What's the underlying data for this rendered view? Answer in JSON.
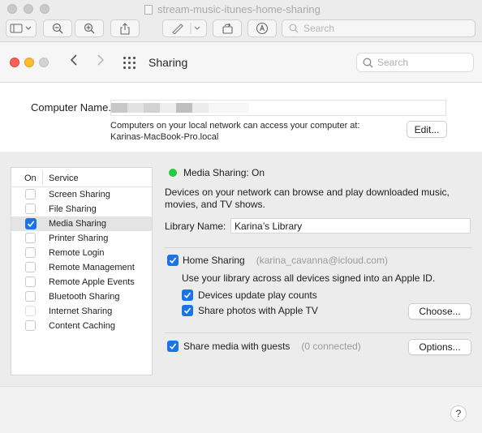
{
  "outer_window": {
    "title": "stream-music-itunes-home-sharing",
    "search_placeholder": "Search",
    "toolbar_icons": [
      "sidebar-icon",
      "zoom-out-icon",
      "zoom-in-icon",
      "share-icon",
      "markup-pen-icon",
      "rotate-icon",
      "annotate-icon"
    ]
  },
  "window": {
    "title": "Sharing",
    "search_placeholder": "Search",
    "colors": {
      "close": "#ff5f57",
      "minimize": "#febc2e",
      "zoom": "#d4d4d4"
    }
  },
  "computer_name": {
    "label": "Computer Name.",
    "description_line1": "Computers on your local network can access your computer at:",
    "description_line2": "Karinas-MacBook-Pro.local",
    "edit_button": "Edit..."
  },
  "services": {
    "header_on": "On",
    "header_service": "Service",
    "items": [
      {
        "label": "Screen Sharing",
        "checked": false,
        "selected": false
      },
      {
        "label": "File Sharing",
        "checked": false,
        "selected": false
      },
      {
        "label": "Media Sharing",
        "checked": true,
        "selected": true
      },
      {
        "label": "Printer Sharing",
        "checked": false,
        "selected": false
      },
      {
        "label": "Remote Login",
        "checked": false,
        "selected": false
      },
      {
        "label": "Remote Management",
        "checked": false,
        "selected": false
      },
      {
        "label": "Remote Apple Events",
        "checked": false,
        "selected": false
      },
      {
        "label": "Bluetooth Sharing",
        "checked": false,
        "selected": false
      },
      {
        "label": "Internet Sharing",
        "checked": false,
        "selected": false
      },
      {
        "label": "Content Caching",
        "checked": false,
        "selected": false
      }
    ]
  },
  "media_sharing": {
    "status": "Media Sharing: On",
    "status_color": "#28c840",
    "description": "Devices on your network can browse and play downloaded music, movies, and TV shows.",
    "library_label": "Library Name:",
    "library_value": "Karina’s Library",
    "home_sharing_label": "Home Sharing",
    "home_sharing_account": "(karina_cavanna@icloud.com)",
    "home_sharing_desc": "Use your library across all devices signed into an Apple ID.",
    "devices_update_label": "Devices update play counts",
    "share_photos_label": "Share photos with Apple TV",
    "choose_button": "Choose...",
    "share_guests_label": "Share media with guests",
    "guests_connected": "(0 connected)",
    "options_button": "Options...",
    "accent_color": "#1a73e8"
  },
  "help_button": "?"
}
